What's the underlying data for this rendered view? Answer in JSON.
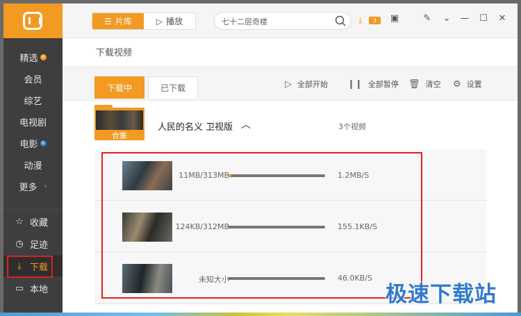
{
  "sidebar": {
    "items": [
      {
        "label": "精选",
        "badge": "H"
      },
      {
        "label": "会员"
      },
      {
        "label": "综艺"
      },
      {
        "label": "电视剧"
      },
      {
        "label": "电影",
        "badge": "N"
      },
      {
        "label": "动漫"
      },
      {
        "label": "更多"
      }
    ],
    "bottom_items": [
      {
        "label": "收藏",
        "icon": "star-icon"
      },
      {
        "label": "足迹",
        "icon": "clock-icon"
      },
      {
        "label": "下载",
        "icon": "download-icon"
      },
      {
        "label": "本地",
        "icon": "folder-icon"
      }
    ]
  },
  "toolbar": {
    "tab_library": "片库",
    "tab_play": "播放",
    "search_value": "七十二层奇楼",
    "download_count": "3"
  },
  "page": {
    "title": "下载视频",
    "tab_downloading": "下载中",
    "tab_downloaded": "已下载",
    "actions": {
      "start_all": "全部开始",
      "pause_all": "全部暂停",
      "clear": "清空",
      "settings": "设置"
    }
  },
  "group": {
    "badge": "合集",
    "title": "人民的名义 卫视版",
    "count": "3个视频"
  },
  "downloads": [
    {
      "size": "11MB/313MB",
      "speed": "1.2MB/S",
      "progress": 0.035
    },
    {
      "size": "124KB/312MB",
      "speed": "155.1KB/S",
      "progress": 0.0
    },
    {
      "size": "未知大小",
      "speed": "46.0KB/S",
      "progress": 0.0
    }
  ],
  "watermark": "极速下载站",
  "colors": {
    "accent": "#f29a21",
    "sidebar": "#3e3e3e",
    "highlight": "#e02020"
  }
}
